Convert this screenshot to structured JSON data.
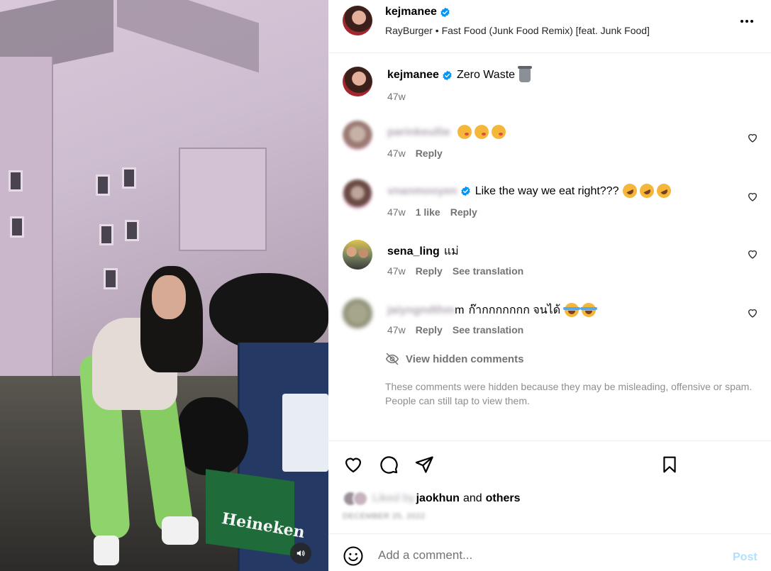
{
  "post": {
    "author": "kejmanee",
    "song": "RayBurger • Fast Food (Junk Food Remix) [feat. Junk Food]",
    "caption_author": "kejmanee",
    "caption": "Zero Waste",
    "caption_time": "47w",
    "media_crate_text": "Heineken"
  },
  "comments": [
    {
      "user": "parinkeullie",
      "text": "",
      "emoji": [
        "kiss",
        "kiss",
        "kiss"
      ],
      "time": "47w",
      "likes": "",
      "reply": "Reply",
      "translate": ""
    },
    {
      "user": "vnanmooyen",
      "text": "Like the way we eat right???",
      "emoji": [
        "rofl",
        "rofl",
        "rofl"
      ],
      "time": "47w",
      "likes": "1 like",
      "reply": "Reply",
      "translate": ""
    },
    {
      "user": "sena_ling",
      "text": "แม่",
      "emoji": [],
      "time": "47w",
      "likes": "",
      "reply": "Reply",
      "translate": "See translation"
    },
    {
      "user": "jaiyngndthm",
      "user_visible": "m",
      "text": "ก๊ากกกกกกก จนได้",
      "emoji": [
        "joy",
        "joy"
      ],
      "time": "47w",
      "likes": "",
      "reply": "Reply",
      "translate": "See translation"
    }
  ],
  "hidden": {
    "link": "View hidden comments",
    "note": "These comments were hidden because they may be misleading, offensive or spam. People can still tap to view them."
  },
  "likes": {
    "blurred_prefix": "Liked by",
    "user": "jaokhun",
    "and": "and",
    "others": "others",
    "date": "DECEMBER 25, 2022"
  },
  "composer": {
    "placeholder": "Add a comment...",
    "post": "Post"
  },
  "colors": {
    "verified": "#0095f6",
    "post_disabled": "#b2dffc",
    "muted": "#737373"
  }
}
